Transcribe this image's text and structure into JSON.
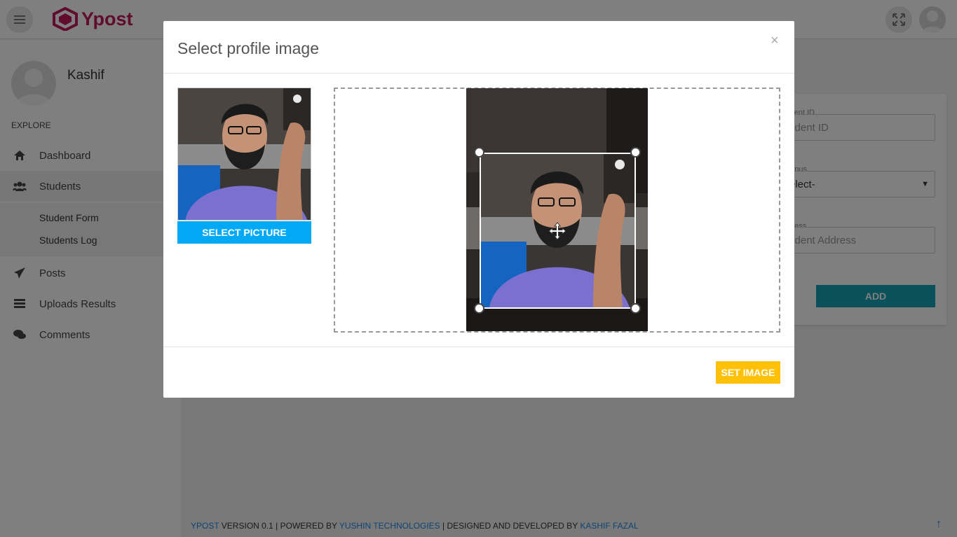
{
  "app": {
    "logo_text": "Ypost"
  },
  "sidebar": {
    "user_name": "Kashif",
    "section_label": "EXPLORE",
    "items": [
      {
        "label": "Dashboard",
        "icon": "home-icon"
      },
      {
        "label": "Students",
        "icon": "users-icon"
      },
      {
        "label": "Posts",
        "icon": "paper-plane-icon"
      },
      {
        "label": "Uploads Results",
        "icon": "list-icon"
      },
      {
        "label": "Comments",
        "icon": "comments-icon"
      }
    ],
    "sub_items": [
      {
        "label": "Student Form"
      },
      {
        "label": "Students Log"
      }
    ]
  },
  "form": {
    "student_id_label": "Student ID",
    "student_id_placeholder": "Student ID",
    "campus_label": "Campus",
    "campus_selected": "-Select-",
    "address_label": "Address",
    "address_placeholder": "Student Address",
    "add_label": "ADD"
  },
  "footer": {
    "brand": "YPOST",
    "version_text": " VERSION 0.1 | POWERED BY ",
    "company": "YUSHIN TECHNOLOGIES",
    "designed_text": " | DESIGNED AND DEVELOPED BY ",
    "developer": "KASHIF FAZAL"
  },
  "modal": {
    "title": "Select profile image",
    "close_symbol": "×",
    "select_picture_label": "SELECT PICTURE",
    "set_image_label": "SET IMAGE"
  },
  "colors": {
    "brand": "#c2185b",
    "select_button": "#03a9f4",
    "set_button": "#ffc107",
    "add_button": "#17a2b8"
  }
}
